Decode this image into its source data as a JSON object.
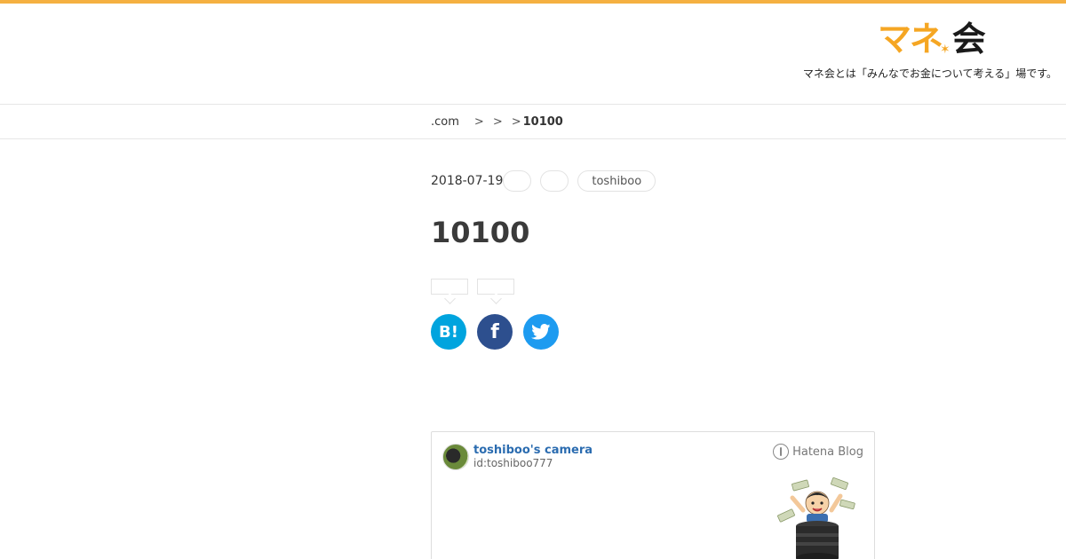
{
  "header": {
    "logo_text_orange": "マネ",
    "logo_text_dark": "会",
    "tagline": "マネ会とは「みんなでお金について考える」場です。",
    "accent_color": "#f5b041"
  },
  "breadcrumb": {
    "items": [
      ".com",
      ">",
      ">",
      ">"
    ],
    "current": "10100"
  },
  "article": {
    "date": "2018-07-19",
    "tags": [
      "",
      "",
      "toshiboo"
    ],
    "title": "10100"
  },
  "share": {
    "hatena_label": "B!",
    "facebook_label": "f",
    "icons": [
      "hatena-bookmark-icon",
      "facebook-icon",
      "twitter-icon"
    ]
  },
  "blog_card": {
    "name": "toshiboo's camera",
    "id": "id:toshiboo777",
    "service": "Hatena Blog"
  }
}
